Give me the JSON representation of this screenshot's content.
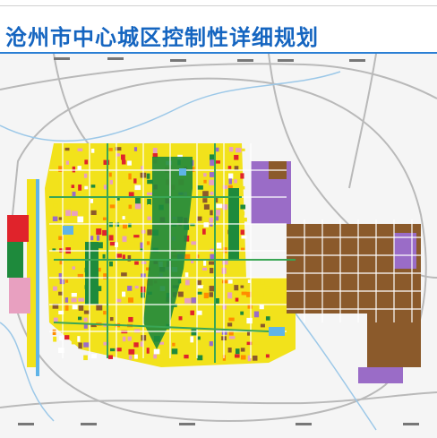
{
  "title": "沧州市中心城区控制性详细规划",
  "map": {
    "road_labels_top": [
      "",
      ""
    ],
    "colors": {
      "residential": "#f2e21b",
      "green": "#1e8a3c",
      "commercial": "#e0232b",
      "public": "#e8a0c0",
      "industrial": "#8b5a2b",
      "warehouse": "#9a6cc7",
      "water": "#5fb4e8",
      "road": "#ffffff",
      "background": "#f4f4f4"
    }
  }
}
